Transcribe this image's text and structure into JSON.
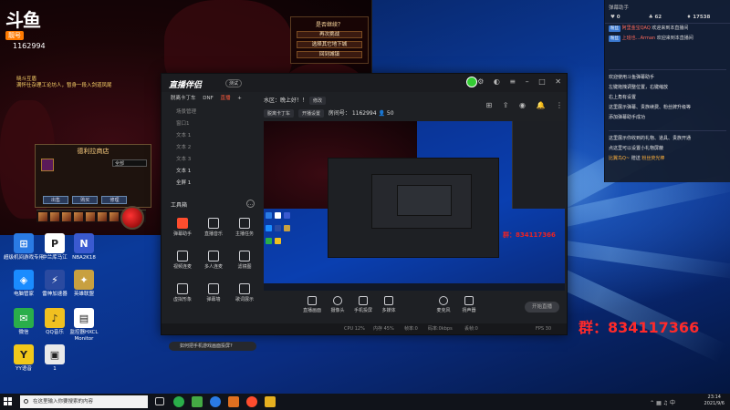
{
  "game": {
    "logo_text": "斗鱼",
    "logo_badge": "靓号",
    "room_id": "1162994",
    "chat_line1": "晓斗互盾",
    "chat_line2": "满怀仕杂理工论坊人，暂身一段入剑道凤尾",
    "dialog_title": "是否继续？",
    "dialog_options": [
      "再次挑战",
      "选择其它地下城",
      "回到城镇"
    ],
    "shop_title": "德利拉商店",
    "shop_filter": "全部",
    "shop_buttons": [
      "出售",
      "购买",
      "修理"
    ]
  },
  "desktop_icons": [
    {
      "label": "超级机间游戏专用",
      "icon": "network-icon",
      "color": "#2a7be4",
      "glyph": "⊞"
    },
    {
      "label": "中兰库马江",
      "icon": "p-app-icon",
      "color": "#ffffff",
      "glyph": "P"
    },
    {
      "label": "NBA2K18",
      "icon": "nba-icon",
      "color": "#3a5ad0",
      "glyph": "N"
    },
    {
      "label": "电脑管家",
      "icon": "shield-icon",
      "color": "#1a8cff",
      "glyph": "◈"
    },
    {
      "label": "雷神加速器",
      "icon": "thunder-icon",
      "color": "#2a4aa0",
      "glyph": "⚡"
    },
    {
      "label": "英雄联盟",
      "icon": "lol-icon",
      "color": "#c8a040",
      "glyph": "✦"
    },
    {
      "label": "微信",
      "icon": "wechat-icon",
      "color": "#2aae4a",
      "glyph": "✉"
    },
    {
      "label": "QQ音乐",
      "icon": "music-icon",
      "color": "#f0c020",
      "glyph": "♪"
    },
    {
      "label": "监控器HXCL Monitor",
      "icon": "doc-icon",
      "color": "#ffffff",
      "glyph": "▤"
    },
    {
      "label": "YY语音",
      "icon": "yy-icon",
      "color": "#f2c81a",
      "glyph": "Y"
    },
    {
      "label": "1",
      "icon": "image-icon",
      "color": "#eaeaea",
      "glyph": "▣"
    }
  ],
  "app": {
    "logo": "直播伴侣",
    "version": "测试",
    "scene_tabs": [
      "脱离卡丁车",
      "DNF",
      "直播"
    ],
    "sources": [
      "场景管理",
      "窗口1",
      "文本 1",
      "文本 2",
      "文本 3",
      "文本 1",
      "全屏 1"
    ],
    "tools_title": "工具箱",
    "tools": [
      {
        "label": "弹幕助手",
        "hot": true
      },
      {
        "label": "直播音乐",
        "hot": false
      },
      {
        "label": "主播任务",
        "hot": false
      },
      {
        "label": "视频连麦",
        "hot": false
      },
      {
        "label": "多人连麦",
        "hot": false
      },
      {
        "label": "滤镜图",
        "hot": false
      },
      {
        "label": "虚拟形象",
        "hot": false
      },
      {
        "label": "弹幕墙",
        "hot": false
      },
      {
        "label": "歌词展示",
        "hot": false
      }
    ],
    "notice": "如何把手机游戏画面投屏?",
    "preview_title": "水区：晚上好！！",
    "preview_edit": "修改",
    "preview_category": "脱离卡丁车",
    "preview_category2": "开播设置",
    "room_label": "房间号：",
    "room_value": "1162994",
    "viewers": "50",
    "preview_qq": "群：834117366",
    "bottom_tools": [
      "直播画面",
      "摄像头",
      "手机投屏",
      "多媒体",
      "麦克风",
      "扬声器"
    ],
    "start_live": "开始直播",
    "status_items": [
      "CPU 12%",
      "内存 45%",
      "帧率:0",
      "码率:0kbps",
      "丢帧:0",
      "FPS 30"
    ]
  },
  "chat": {
    "title": "弹幕助手",
    "stats": [
      "0",
      "62",
      "17538"
    ],
    "messages": [
      {
        "badge": "粉丝",
        "name": "阿里金宝QAQ",
        "text": "欢迎来到本直播间"
      },
      {
        "badge": "粉丝",
        "name": "上班也…Arman",
        "text": "欢迎来到本直播间"
      }
    ],
    "system": [
      "欢迎使用斗鱼弹幕助手",
      "左键拖拽调整位置，右键缩放",
      "右上角有设置",
      "这里展示弹幕、贵族续费、粉丝牌升级等",
      "添加弹幕助手成功"
    ],
    "system2": [
      "这里展示你收到的礼物、道具、贵族开通",
      "点这里可以设置小礼物屏蔽"
    ],
    "gift_line": {
      "name": "比翼鸟Q~",
      "action": "赠送",
      "detail": "粉丝荧光棒"
    }
  },
  "qq_text": "群：834117366",
  "taskbar": {
    "search_placeholder": "在这里输入你要搜索的内容",
    "time": "23:14",
    "date": "2021/9/6"
  }
}
